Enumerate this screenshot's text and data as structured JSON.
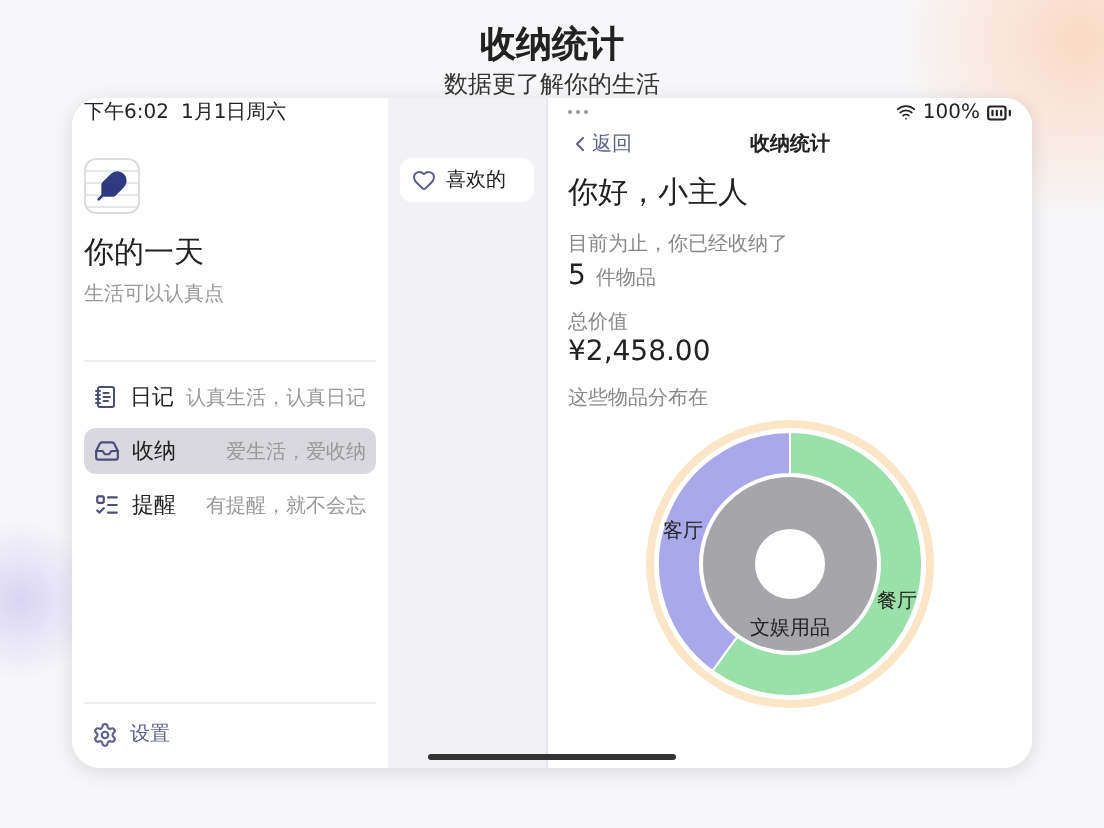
{
  "page_header": {
    "title": "收纳统计",
    "subtitle": "数据更了解你的生活"
  },
  "status_bar": {
    "time": "下午6:02",
    "date": "1月1日周六",
    "battery": "100%"
  },
  "sidebar": {
    "app_title": "你的一天",
    "app_subtitle": "生活可以认真点",
    "items": [
      {
        "label": "日记",
        "description": "认真生活，认真日记",
        "selected": false
      },
      {
        "label": "收纳",
        "description": "爱生活，爱收纳",
        "selected": true
      },
      {
        "label": "提醒",
        "description": "有提醒，就不会忘",
        "selected": false
      }
    ],
    "settings": "设置"
  },
  "filters": [
    {
      "label": "喜欢的"
    }
  ],
  "detail": {
    "back": "返回",
    "title": "收纳统计",
    "greeting": "你好，小主人",
    "count_caption": "目前为止，你已经收纳了",
    "count": "5",
    "count_unit": "件物品",
    "value_caption": "总价值",
    "value": "¥2,458.00",
    "distribution_caption": "这些物品分布在",
    "inner_ring": {
      "label": "文娱用品",
      "color": "#a6a5aa"
    },
    "outer_ring": [
      {
        "label": "餐厅",
        "color": "#9ae0a9"
      },
      {
        "label": "客厅",
        "color": "#a9a8e8"
      }
    ]
  }
}
